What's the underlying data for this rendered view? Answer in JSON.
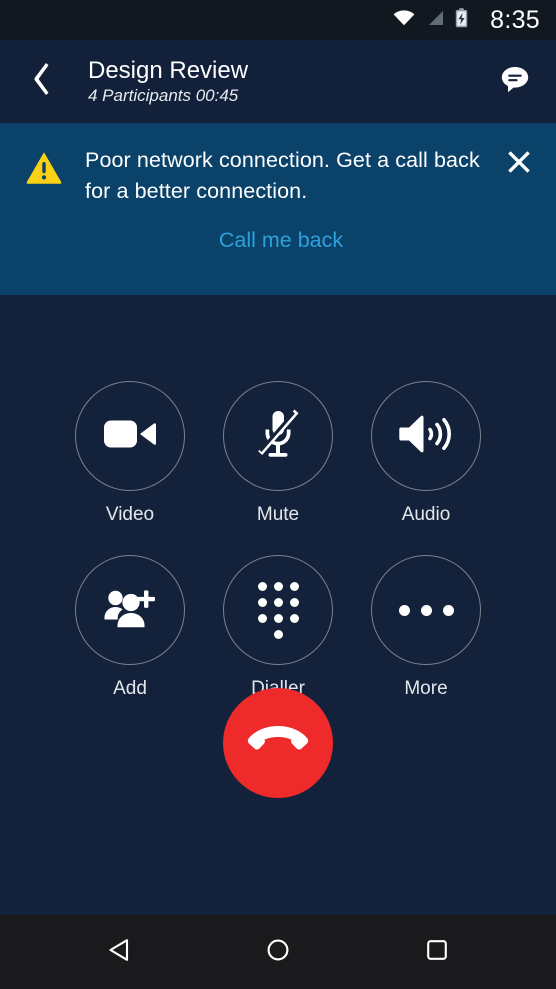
{
  "status_bar": {
    "time": "8:35",
    "icons": [
      "wifi-icon",
      "cellular-signal-icon",
      "battery-charging-icon"
    ]
  },
  "header": {
    "back_icon": "chevron-left-icon",
    "title": "Design Review",
    "subtitle": "4 Participants 00:45",
    "chat_icon": "chat-bubble-icon"
  },
  "banner": {
    "warning_icon": "warning-triangle-icon",
    "message": "Poor network connection. Get a call back for a better connection.",
    "link_label": "Call me back",
    "close_icon": "close-x-icon",
    "background_color": "#0a4269",
    "link_color": "#2ea1dd",
    "warning_color": "#fbd116"
  },
  "controls": {
    "rows": [
      [
        {
          "id": "video",
          "label": "Video",
          "icon": "video-camera-icon"
        },
        {
          "id": "mute",
          "label": "Mute",
          "icon": "microphone-muted-icon"
        },
        {
          "id": "audio",
          "label": "Audio",
          "icon": "speaker-volume-icon"
        }
      ],
      [
        {
          "id": "add",
          "label": "Add",
          "icon": "add-person-icon"
        },
        {
          "id": "dialler",
          "label": "Dialler",
          "icon": "keypad-dots-icon"
        },
        {
          "id": "more",
          "label": "More",
          "icon": "more-horizontal-icon"
        }
      ]
    ],
    "end_call": {
      "icon": "end-call-handset-icon",
      "color": "#ee2a2a"
    }
  },
  "nav_bar": {
    "back_icon": "nav-back-triangle-icon",
    "home_icon": "nav-home-circle-icon",
    "recents_icon": "nav-recents-square-icon"
  },
  "theme": {
    "background": "#13223a",
    "header_background": "#12203a",
    "status_bar_background": "#111820",
    "nav_bar_background": "#1a1a1c",
    "circle_border": "#78828f"
  }
}
